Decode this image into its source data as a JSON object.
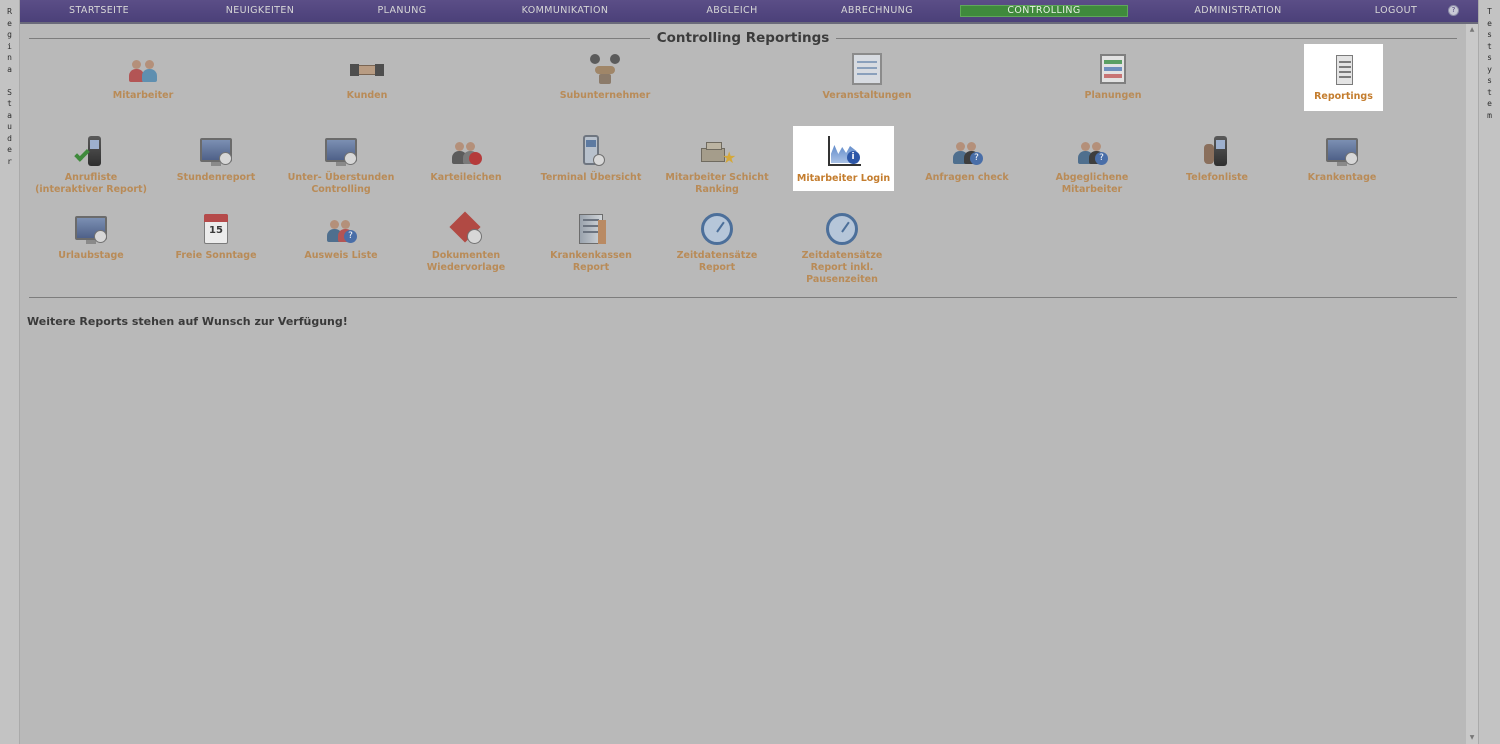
{
  "sidebar_left": {
    "text": [
      "R",
      "e",
      "g",
      "i",
      "n",
      "a",
      " ",
      "S",
      "t",
      "a",
      "u",
      "d",
      "e",
      "r"
    ]
  },
  "sidebar_right": {
    "text": [
      "T",
      "e",
      "s",
      "t",
      "s",
      "y",
      "s",
      "t",
      "e",
      "m"
    ]
  },
  "nav": {
    "items": [
      "STARTSEITE",
      "NEUIGKEITEN",
      "PLANUNG",
      "KOMMUNIKATION",
      "ABGLEICH",
      "ABRECHNUNG",
      "CONTROLLING",
      "ADMINISTRATION",
      "LOGOUT"
    ],
    "active": "CONTROLLING",
    "accent_color": "#3f8a3c",
    "bar_color": "#4b4079"
  },
  "page": {
    "title": "Controlling Reportings",
    "footer_note": "Weitere Reports stehen auf Wunsch zur Verfügung!"
  },
  "row1": [
    {
      "label": "Mitarbeiter",
      "icon": "people-icon"
    },
    {
      "label": "Kunden",
      "icon": "handshake-icon"
    },
    {
      "label": "Subunternehmer",
      "icon": "subcontractor-icon"
    },
    {
      "label": "Veranstaltungen",
      "icon": "calendar-board-icon"
    },
    {
      "label": "Planungen",
      "icon": "planning-board-icon"
    },
    {
      "label": "Reportings",
      "icon": "report-document-icon",
      "selected": true
    }
  ],
  "row2": [
    {
      "line1": "Anrufliste",
      "line2": "(interaktiver Report)",
      "icon": "phone-check-icon"
    },
    {
      "line1": "Stundenreport",
      "line2": "",
      "icon": "monitor-clock-icon"
    },
    {
      "line1": "Unter- Überstunden",
      "line2": "Controlling",
      "icon": "monitor-clock-icon"
    },
    {
      "line1": "Karteileichen",
      "line2": "",
      "icon": "people-block-icon"
    },
    {
      "line1": "Terminal Übersicht",
      "line2": "",
      "icon": "terminal-icon"
    },
    {
      "line1": "Mitarbeiter Schicht",
      "line2": "Ranking",
      "icon": "ranking-icon"
    },
    {
      "line1": "Mitarbeiter Login",
      "line2": "",
      "icon": "login-chart-icon",
      "selected": true
    },
    {
      "line1": "Anfragen check",
      "line2": "",
      "icon": "people-question-icon"
    },
    {
      "line1": "Abgeglichene",
      "line2": "Mitarbeiter",
      "icon": "people-question-icon"
    },
    {
      "line1": "Telefonliste",
      "line2": "",
      "icon": "phone-icon"
    },
    {
      "line1": "Krankentage",
      "line2": "",
      "icon": "monitor-clock-icon"
    }
  ],
  "row3": [
    {
      "line1": "Urlaubstage",
      "line2": "",
      "line3": "",
      "icon": "monitor-clock-icon"
    },
    {
      "line1": "Freie Sonntage",
      "line2": "",
      "line3": "",
      "icon": "calendar-15-icon",
      "day": "15"
    },
    {
      "line1": "Ausweis Liste",
      "line2": "",
      "line3": "",
      "icon": "people-question-icon"
    },
    {
      "line1": "Dokumenten",
      "line2": "Wiedervorlage",
      "line3": "",
      "icon": "document-clock-icon"
    },
    {
      "line1": "Krankenkassen",
      "line2": "Report",
      "line3": "",
      "icon": "building-icon"
    },
    {
      "line1": "Zeitdatensätze",
      "line2": "Report",
      "line3": "",
      "icon": "stopwatch-icon"
    },
    {
      "line1": "Zeitdatensätze",
      "line2": "Report inkl.",
      "line3": "Pausenzeiten",
      "icon": "stopwatch-icon"
    }
  ]
}
